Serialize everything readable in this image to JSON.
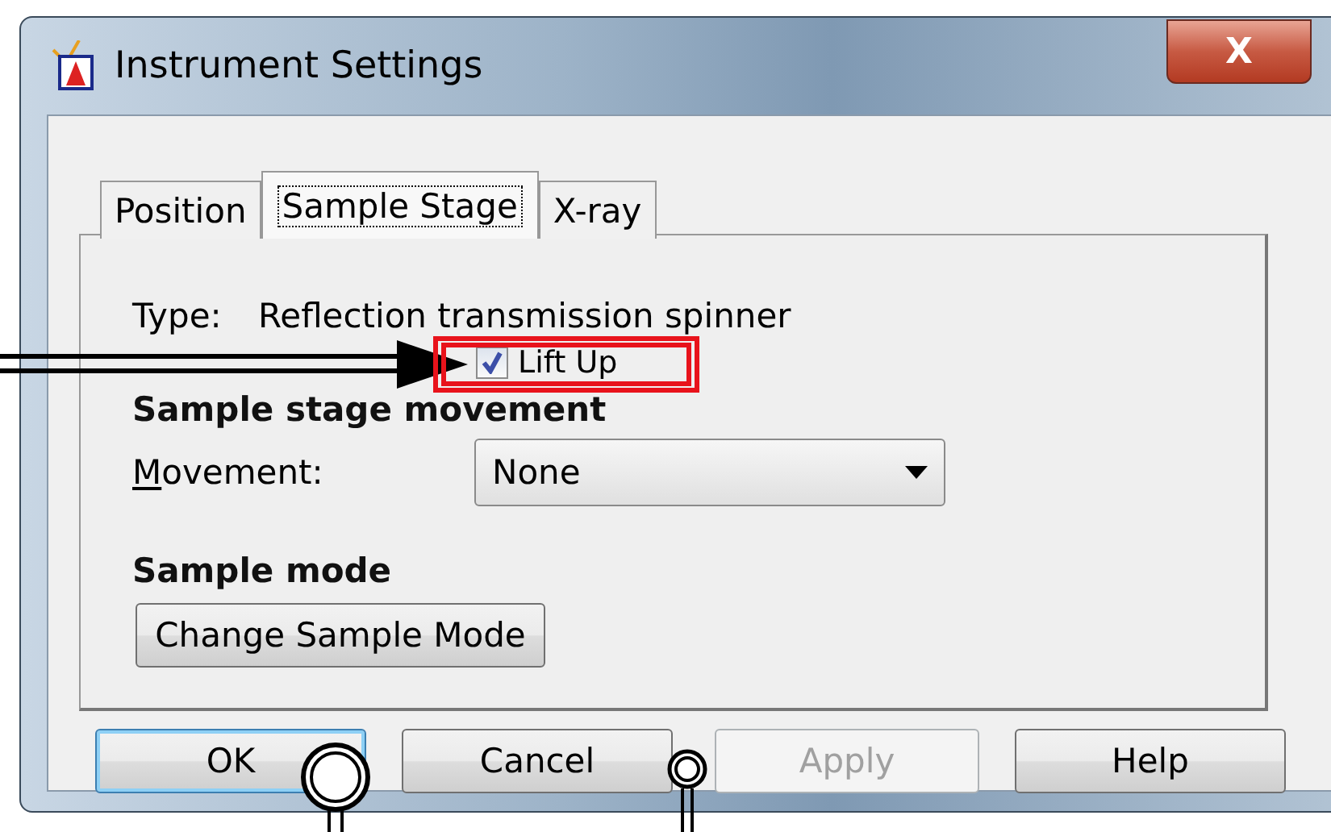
{
  "window": {
    "title": "Instrument Settings",
    "close": "X"
  },
  "tabs": [
    {
      "label": "Position",
      "selected": false
    },
    {
      "label": "Sample Stage",
      "selected": true
    },
    {
      "label": "X-ray",
      "selected": false
    }
  ],
  "type": {
    "label": "Type:",
    "value": "Reflection transmission spinner"
  },
  "lift_up": {
    "label": "Lift Up",
    "checked": true
  },
  "movement_section": {
    "heading": "Sample stage movement",
    "label": "Movement:",
    "mnemonic": true,
    "value": "None"
  },
  "mode_section": {
    "heading": "Sample mode",
    "button": "Change Sample Mode"
  },
  "buttons": [
    {
      "label": "OK",
      "default": true,
      "disabled": false
    },
    {
      "label": "Cancel",
      "default": false,
      "disabled": false
    },
    {
      "label": "Apply",
      "default": false,
      "disabled": true
    },
    {
      "label": "Help",
      "default": false,
      "disabled": false
    }
  ]
}
